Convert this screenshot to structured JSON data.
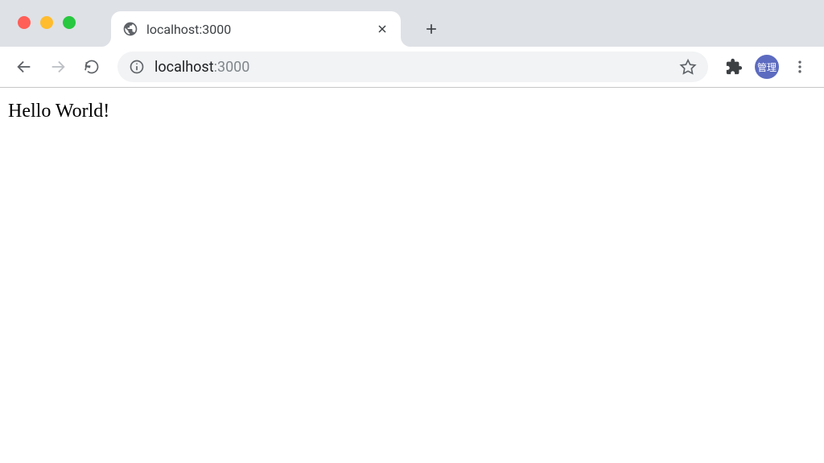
{
  "window": {
    "controls": [
      "close",
      "minimize",
      "maximize"
    ]
  },
  "tabs": {
    "active": {
      "title": "localhost:3000",
      "favicon": "globe-icon"
    }
  },
  "addressBar": {
    "host": "localhost",
    "port": ":3000",
    "infoIcon": "info-icon"
  },
  "toolbar": {
    "profileLabel": "管理"
  },
  "page": {
    "body": "Hello World!"
  }
}
